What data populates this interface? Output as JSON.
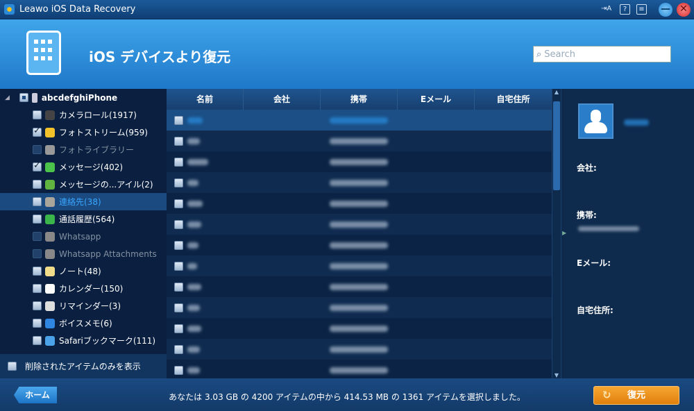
{
  "window": {
    "title": "Leawo iOS Data Recovery"
  },
  "header": {
    "title": "iOS デバイスより復元",
    "search_placeholder": "Search"
  },
  "tree": {
    "device": "abcdefghiPhone",
    "items": [
      {
        "label": "カメラロール(1917)",
        "state": "unchecked",
        "icon": "camera-icon",
        "color": "#444"
      },
      {
        "label": "フォトストリーム(959)",
        "state": "checked",
        "icon": "sunflower-icon",
        "color": "#f3c22a"
      },
      {
        "label": "フォトライブラリー",
        "state": "disabled",
        "icon": "photo-library-icon",
        "color": "#999"
      },
      {
        "label": "メッセージ(402)",
        "state": "checked",
        "icon": "message-icon",
        "color": "#4cc34a"
      },
      {
        "label": "メッセージの...アイル(2)",
        "state": "unchecked",
        "icon": "attachment-icon",
        "color": "#5fb540"
      },
      {
        "label": "連絡先(38)",
        "state": "unchecked",
        "icon": "contacts-icon",
        "color": "#a9a59a",
        "selected": true
      },
      {
        "label": "通話履歴(564)",
        "state": "unchecked",
        "icon": "phone-icon",
        "color": "#3ab54a"
      },
      {
        "label": "Whatsapp",
        "state": "disabled",
        "icon": "whatsapp-icon",
        "color": "#888"
      },
      {
        "label": "Whatsapp Attachments",
        "state": "disabled",
        "icon": "whatsapp-attachment-icon",
        "color": "#888"
      },
      {
        "label": "ノート(48)",
        "state": "unchecked",
        "icon": "notes-icon",
        "color": "#f1dc8a"
      },
      {
        "label": "カレンダー(150)",
        "state": "unchecked",
        "icon": "calendar-icon",
        "color": "#fff"
      },
      {
        "label": "リマインダー(3)",
        "state": "unchecked",
        "icon": "reminder-icon",
        "color": "#ddd"
      },
      {
        "label": "ボイスメモ(6)",
        "state": "unchecked",
        "icon": "voice-memo-icon",
        "color": "#2f86e0"
      },
      {
        "label": "Safariブックマーク(111)",
        "state": "unchecked",
        "icon": "safari-icon",
        "color": "#4aa3e8"
      }
    ],
    "deleted_only_label": "削除されたアイテムのみを表示"
  },
  "table": {
    "columns": [
      "名前",
      "会社",
      "携帯",
      "Eメール",
      "自宅住所"
    ],
    "row_count": 13
  },
  "detail": {
    "company_label": "会社:",
    "mobile_label": "携帯:",
    "email_label": "Eメール:",
    "address_label": "自宅住所:"
  },
  "footer": {
    "home_label": "ホーム",
    "status": "あなたは 3.03 GB の 4200 アイテムの中から 414.53 MB の 1361 アイテムを選択しました。",
    "restore_label": "復元"
  }
}
